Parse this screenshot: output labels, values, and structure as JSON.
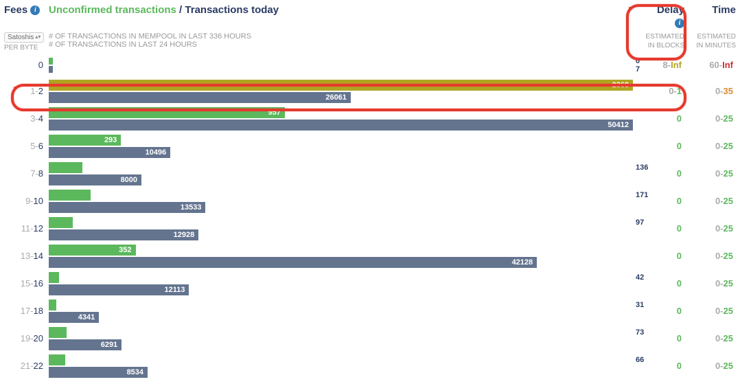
{
  "header": {
    "fees_label": "Fees",
    "unconfirmed_label": "Unconfirmed transactions",
    "slash": " / ",
    "today_label": "Transactions today",
    "delay_label": "Delay",
    "time_label": "Time"
  },
  "subhead": {
    "unit": "Satoshis",
    "per_byte": "PER BYTE",
    "line1": "# OF TRANSACTIONS IN MEMPOOL IN LAST 336 HOURS",
    "line2": "# OF TRANSACTIONS IN LAST 24 HOURS",
    "est_blocks_l1": "ESTIMATED",
    "est_blocks_l2": "IN BLOCKS",
    "est_min_l1": "ESTIMATED",
    "est_min_l2": "IN MINUTES"
  },
  "chart_data": {
    "type": "bar",
    "title": "Unconfirmed transactions / Transactions today by fee rate",
    "xlabel": "# of transactions",
    "ylabel": "Fee (Satoshis per byte)",
    "max_top": 2368,
    "max_bottom": 50412,
    "rows": [
      {
        "fee_lo": "",
        "fee_hi": "0",
        "unconfirmed": 0,
        "today": 7,
        "delay_lo": "8",
        "delay_hi": "Inf",
        "time_lo": "60",
        "time_hi": "Inf",
        "delay_color": "olive",
        "time_color": "red",
        "top_color": "green",
        "highlight": false,
        "thin": true
      },
      {
        "fee_lo": "1",
        "fee_hi": "2",
        "unconfirmed": 2368,
        "today": 26061,
        "delay_lo": "0",
        "delay_hi": "1",
        "time_lo": "0",
        "time_hi": "35",
        "delay_color": "green",
        "time_color": "orange",
        "top_color": "olive",
        "highlight": true,
        "thin": false
      },
      {
        "fee_lo": "3",
        "fee_hi": "4",
        "unconfirmed": 957,
        "today": 50412,
        "delay_lo": "",
        "delay_hi": "0",
        "time_lo": "0",
        "time_hi": "25",
        "delay_color": "green",
        "time_color": "green",
        "top_color": "green",
        "highlight": false,
        "thin": false
      },
      {
        "fee_lo": "5",
        "fee_hi": "6",
        "unconfirmed": 293,
        "today": 10496,
        "delay_lo": "",
        "delay_hi": "0",
        "time_lo": "0",
        "time_hi": "25",
        "delay_color": "green",
        "time_color": "green",
        "top_color": "green",
        "highlight": false,
        "thin": false
      },
      {
        "fee_lo": "7",
        "fee_hi": "8",
        "unconfirmed": 136,
        "today": 8000,
        "delay_lo": "",
        "delay_hi": "0",
        "time_lo": "0",
        "time_hi": "25",
        "delay_color": "green",
        "time_color": "green",
        "top_color": "green",
        "highlight": false,
        "thin": false
      },
      {
        "fee_lo": "9",
        "fee_hi": "10",
        "unconfirmed": 171,
        "today": 13533,
        "delay_lo": "",
        "delay_hi": "0",
        "time_lo": "0",
        "time_hi": "25",
        "delay_color": "green",
        "time_color": "green",
        "top_color": "green",
        "highlight": false,
        "thin": false
      },
      {
        "fee_lo": "11",
        "fee_hi": "12",
        "unconfirmed": 97,
        "today": 12928,
        "delay_lo": "",
        "delay_hi": "0",
        "time_lo": "0",
        "time_hi": "25",
        "delay_color": "green",
        "time_color": "green",
        "top_color": "green",
        "highlight": false,
        "thin": false
      },
      {
        "fee_lo": "13",
        "fee_hi": "14",
        "unconfirmed": 352,
        "today": 42128,
        "delay_lo": "",
        "delay_hi": "0",
        "time_lo": "0",
        "time_hi": "25",
        "delay_color": "green",
        "time_color": "green",
        "top_color": "green",
        "highlight": false,
        "thin": false
      },
      {
        "fee_lo": "15",
        "fee_hi": "16",
        "unconfirmed": 42,
        "today": 12113,
        "delay_lo": "",
        "delay_hi": "0",
        "time_lo": "0",
        "time_hi": "25",
        "delay_color": "green",
        "time_color": "green",
        "top_color": "green",
        "highlight": false,
        "thin": false
      },
      {
        "fee_lo": "17",
        "fee_hi": "18",
        "unconfirmed": 31,
        "today": 4341,
        "delay_lo": "",
        "delay_hi": "0",
        "time_lo": "0",
        "time_hi": "25",
        "delay_color": "green",
        "time_color": "green",
        "top_color": "green",
        "highlight": false,
        "thin": false
      },
      {
        "fee_lo": "19",
        "fee_hi": "20",
        "unconfirmed": 73,
        "today": 6291,
        "delay_lo": "",
        "delay_hi": "0",
        "time_lo": "0",
        "time_hi": "25",
        "delay_color": "green",
        "time_color": "green",
        "top_color": "green",
        "highlight": false,
        "thin": false
      },
      {
        "fee_lo": "21",
        "fee_hi": "22",
        "unconfirmed": 66,
        "today": 8534,
        "delay_lo": "",
        "delay_hi": "0",
        "time_lo": "0",
        "time_hi": "25",
        "delay_color": "green",
        "time_color": "green",
        "top_color": "green",
        "highlight": false,
        "thin": false
      }
    ]
  }
}
